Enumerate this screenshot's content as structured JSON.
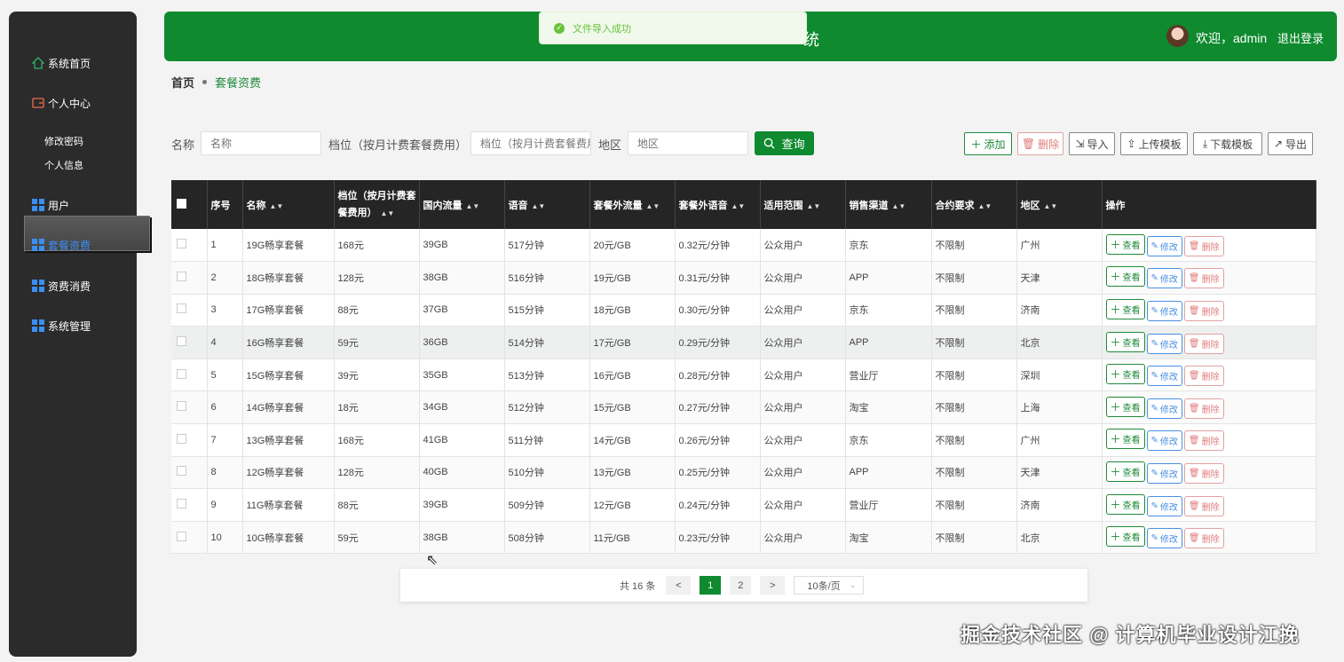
{
  "sidebar": {
    "items": [
      {
        "label": "系统首页"
      },
      {
        "label": "个人中心"
      },
      {
        "label": "用户"
      },
      {
        "label": "套餐资费"
      },
      {
        "label": "资费消费"
      },
      {
        "label": "系统管理"
      }
    ],
    "sub_items": [
      {
        "label": "修改密码"
      },
      {
        "label": "个人信息"
      }
    ]
  },
  "header": {
    "title": "统",
    "welcome": "欢迎，admin",
    "logout": "退出登录"
  },
  "toast": {
    "message": "文件导入成功"
  },
  "breadcrumb": {
    "home": "首页",
    "current": "套餐资费"
  },
  "search": {
    "name_label": "名称",
    "name_placeholder": "名称",
    "tier_label": "档位（按月计费套餐费用）",
    "tier_placeholder": "档位（按月计费套餐费用）",
    "region_label": "地区",
    "region_placeholder": "地区",
    "query_button": "查询"
  },
  "toolbar": {
    "add": "添加",
    "delete": "删除",
    "import": "导入",
    "upload_template": "上传模板",
    "download_template": "下载模板",
    "export": "导出"
  },
  "table": {
    "headers": [
      "序号",
      "名称",
      "档位（按月计费套餐费用）",
      "国内流量",
      "语音",
      "套餐外流量",
      "套餐外语音",
      "适用范围",
      "销售渠道",
      "合约要求",
      "地区",
      "操作"
    ],
    "rows": [
      [
        "1",
        "19G畅享套餐",
        "168元",
        "39GB",
        "517分钟",
        "20元/GB",
        "0.32元/分钟",
        "公众用户",
        "京东",
        "不限制",
        "广州"
      ],
      [
        "2",
        "18G畅享套餐",
        "128元",
        "38GB",
        "516分钟",
        "19元/GB",
        "0.31元/分钟",
        "公众用户",
        "APP",
        "不限制",
        "天津"
      ],
      [
        "3",
        "17G畅享套餐",
        "88元",
        "37GB",
        "515分钟",
        "18元/GB",
        "0.30元/分钟",
        "公众用户",
        "京东",
        "不限制",
        "济南"
      ],
      [
        "4",
        "16G畅享套餐",
        "59元",
        "36GB",
        "514分钟",
        "17元/GB",
        "0.29元/分钟",
        "公众用户",
        "APP",
        "不限制",
        "北京"
      ],
      [
        "5",
        "15G畅享套餐",
        "39元",
        "35GB",
        "513分钟",
        "16元/GB",
        "0.28元/分钟",
        "公众用户",
        "营业厅",
        "不限制",
        "深圳"
      ],
      [
        "6",
        "14G畅享套餐",
        "18元",
        "34GB",
        "512分钟",
        "15元/GB",
        "0.27元/分钟",
        "公众用户",
        "淘宝",
        "不限制",
        "上海"
      ],
      [
        "7",
        "13G畅享套餐",
        "168元",
        "41GB",
        "511分钟",
        "14元/GB",
        "0.26元/分钟",
        "公众用户",
        "京东",
        "不限制",
        "广州"
      ],
      [
        "8",
        "12G畅享套餐",
        "128元",
        "40GB",
        "510分钟",
        "13元/GB",
        "0.25元/分钟",
        "公众用户",
        "APP",
        "不限制",
        "天津"
      ],
      [
        "9",
        "11G畅享套餐",
        "88元",
        "39GB",
        "509分钟",
        "12元/GB",
        "0.24元/分钟",
        "公众用户",
        "营业厅",
        "不限制",
        "济南"
      ],
      [
        "10",
        "10G畅享套餐",
        "59元",
        "38GB",
        "508分钟",
        "11元/GB",
        "0.23元/分钟",
        "公众用户",
        "淘宝",
        "不限制",
        "北京"
      ]
    ],
    "actions": {
      "view": "查看",
      "edit": "修改",
      "delete": "删除"
    }
  },
  "pagination": {
    "total": "共 16 条",
    "prev": "<",
    "pages": [
      "1",
      "2"
    ],
    "next": ">",
    "page_size": "10条/页"
  },
  "watermark": "掘金技术社区 @ 计算机毕业设计江挽",
  "colors": {
    "brand": "#0f8a2f",
    "sidebar": "#2b2b2b",
    "table_header": "#252525"
  }
}
